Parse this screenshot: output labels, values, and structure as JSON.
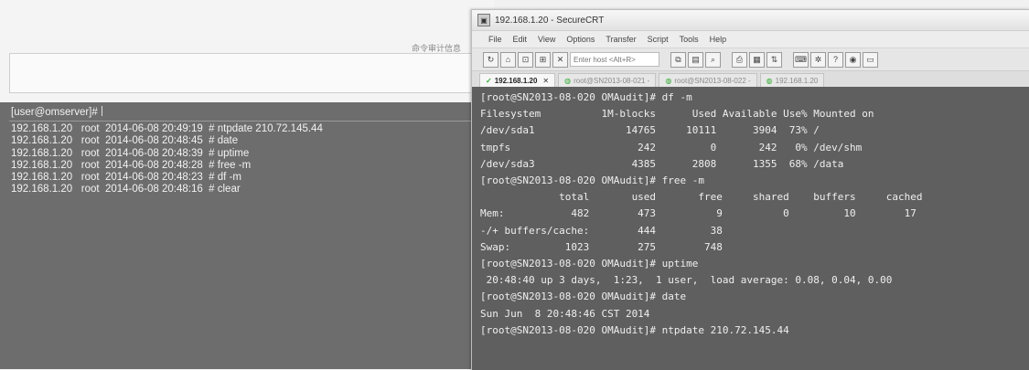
{
  "audit_panel": {
    "title": "命令审计信息",
    "prompt": "[user@omserver]#",
    "records": [
      {
        "host": "192.168.1.20",
        "user": "root",
        "time": "2014-06-08 20:49:19",
        "cmd": "# ntpdate 210.72.145.44"
      },
      {
        "host": "192.168.1.20",
        "user": "root",
        "time": "2014-06-08 20:48:45",
        "cmd": "# date"
      },
      {
        "host": "192.168.1.20",
        "user": "root",
        "time": "2014-06-08 20:48:39",
        "cmd": "# uptime"
      },
      {
        "host": "192.168.1.20",
        "user": "root",
        "time": "2014-06-08 20:48:28",
        "cmd": "# free -m"
      },
      {
        "host": "192.168.1.20",
        "user": "root",
        "time": "2014-06-08 20:48:23",
        "cmd": "# df -m"
      },
      {
        "host": "192.168.1.20",
        "user": "root",
        "time": "2014-06-08 20:48:16",
        "cmd": "# clear"
      }
    ]
  },
  "window": {
    "title": "192.168.1.20 - SecureCRT",
    "menu": [
      "File",
      "Edit",
      "View",
      "Options",
      "Transfer",
      "Script",
      "Tools",
      "Help"
    ],
    "host_placeholder": "Enter host <Alt+R>",
    "tabs": [
      {
        "label": "192.168.1.20",
        "active": true
      },
      {
        "label": "root@SN2013-08-021 -",
        "active": false
      },
      {
        "label": "root@SN2013-08-022 -",
        "active": false
      },
      {
        "label": "192.168.1.20",
        "active": false
      }
    ],
    "terminal_lines": [
      "[root@SN2013-08-020 OMAudit]# df -m",
      "Filesystem          1M-blocks      Used Available Use% Mounted on",
      "/dev/sda1               14765     10111      3904  73% /",
      "tmpfs                     242         0       242   0% /dev/shm",
      "/dev/sda3                4385      2808      1355  68% /data",
      "[root@SN2013-08-020 OMAudit]# free -m",
      "             total       used       free     shared    buffers     cached",
      "Mem:           482        473          9          0         10        17",
      "-/+ buffers/cache:        444         38",
      "Swap:         1023        275        748",
      "[root@SN2013-08-020 OMAudit]# uptime",
      " 20:48:40 up 3 days,  1:23,  1 user,  load average: 0.08, 0.04, 0.00",
      "[root@SN2013-08-020 OMAudit]# date",
      "Sun Jun  8 20:48:46 CST 2014",
      "[root@SN2013-08-020 OMAudit]# ntpdate 210.72.145.44"
    ]
  }
}
